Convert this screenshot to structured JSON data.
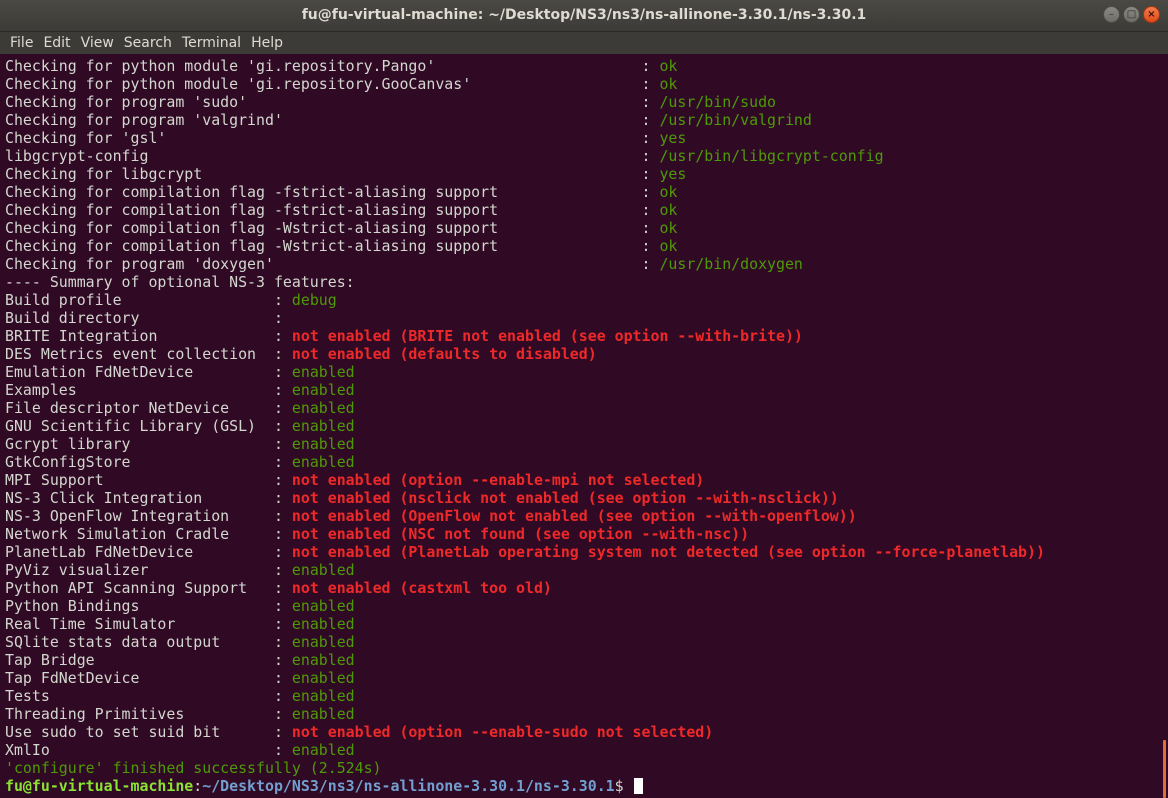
{
  "window": {
    "title": "fu@fu-virtual-machine: ~/Desktop/NS3/ns3/ns-allinone-3.30.1/ns-3.30.1",
    "buttons": {
      "minimize": "–",
      "maximize": "□",
      "close": "×"
    }
  },
  "menu": [
    "File",
    "Edit",
    "View",
    "Search",
    "Terminal",
    "Help"
  ],
  "colors": {
    "background": "#300a24",
    "ok_green": "#4e9a06",
    "error_red": "#ef2929",
    "prompt_user": "#8ae234",
    "prompt_path": "#729fcf"
  },
  "lines": [
    [
      {
        "t": "Checking for python module 'gi.repository.Pango'                       : ",
        "c": "w"
      },
      {
        "t": "ok",
        "c": "g"
      }
    ],
    [
      {
        "t": "Checking for python module 'gi.repository.GooCanvas'                   : ",
        "c": "w"
      },
      {
        "t": "ok",
        "c": "g"
      }
    ],
    [
      {
        "t": "Checking for program 'sudo'                                            : ",
        "c": "w"
      },
      {
        "t": "/usr/bin/sudo",
        "c": "g"
      }
    ],
    [
      {
        "t": "Checking for program 'valgrind'                                        : ",
        "c": "w"
      },
      {
        "t": "/usr/bin/valgrind",
        "c": "g"
      }
    ],
    [
      {
        "t": "Checking for 'gsl'                                                     : ",
        "c": "w"
      },
      {
        "t": "yes",
        "c": "g"
      }
    ],
    [
      {
        "t": "libgcrypt-config                                                       : ",
        "c": "w"
      },
      {
        "t": "/usr/bin/libgcrypt-config",
        "c": "g"
      }
    ],
    [
      {
        "t": "Checking for libgcrypt                                                 : ",
        "c": "w"
      },
      {
        "t": "yes",
        "c": "g"
      }
    ],
    [
      {
        "t": "Checking for compilation flag -fstrict-aliasing support                : ",
        "c": "w"
      },
      {
        "t": "ok",
        "c": "g"
      }
    ],
    [
      {
        "t": "Checking for compilation flag -fstrict-aliasing support                : ",
        "c": "w"
      },
      {
        "t": "ok",
        "c": "g"
      }
    ],
    [
      {
        "t": "Checking for compilation flag -Wstrict-aliasing support                : ",
        "c": "w"
      },
      {
        "t": "ok",
        "c": "g"
      }
    ],
    [
      {
        "t": "Checking for compilation flag -Wstrict-aliasing support                : ",
        "c": "w"
      },
      {
        "t": "ok",
        "c": "g"
      }
    ],
    [
      {
        "t": "Checking for program 'doxygen'                                         : ",
        "c": "w"
      },
      {
        "t": "/usr/bin/doxygen",
        "c": "g"
      }
    ],
    [
      {
        "t": "---- Summary of optional NS-3 features:",
        "c": "w"
      }
    ],
    [
      {
        "t": "Build profile                 : ",
        "c": "w"
      },
      {
        "t": "debug",
        "c": "g"
      }
    ],
    [
      {
        "t": "Build directory               : ",
        "c": "w"
      }
    ],
    [
      {
        "t": "BRITE Integration             : ",
        "c": "w"
      },
      {
        "t": "not enabled (BRITE not enabled (see option --with-brite))",
        "c": "r"
      }
    ],
    [
      {
        "t": "DES Metrics event collection  : ",
        "c": "w"
      },
      {
        "t": "not enabled (defaults to disabled)",
        "c": "r"
      }
    ],
    [
      {
        "t": "Emulation FdNetDevice         : ",
        "c": "w"
      },
      {
        "t": "enabled",
        "c": "g"
      }
    ],
    [
      {
        "t": "Examples                      : ",
        "c": "w"
      },
      {
        "t": "enabled",
        "c": "g"
      }
    ],
    [
      {
        "t": "File descriptor NetDevice     : ",
        "c": "w"
      },
      {
        "t": "enabled",
        "c": "g"
      }
    ],
    [
      {
        "t": "GNU Scientific Library (GSL)  : ",
        "c": "w"
      },
      {
        "t": "enabled",
        "c": "g"
      }
    ],
    [
      {
        "t": "Gcrypt library                : ",
        "c": "w"
      },
      {
        "t": "enabled",
        "c": "g"
      }
    ],
    [
      {
        "t": "GtkConfigStore                : ",
        "c": "w"
      },
      {
        "t": "enabled",
        "c": "g"
      }
    ],
    [
      {
        "t": "MPI Support                   : ",
        "c": "w"
      },
      {
        "t": "not enabled (option --enable-mpi not selected)",
        "c": "r"
      }
    ],
    [
      {
        "t": "NS-3 Click Integration        : ",
        "c": "w"
      },
      {
        "t": "not enabled (nsclick not enabled (see option --with-nsclick))",
        "c": "r"
      }
    ],
    [
      {
        "t": "NS-3 OpenFlow Integration     : ",
        "c": "w"
      },
      {
        "t": "not enabled (OpenFlow not enabled (see option --with-openflow))",
        "c": "r"
      }
    ],
    [
      {
        "t": "Network Simulation Cradle     : ",
        "c": "w"
      },
      {
        "t": "not enabled (NSC not found (see option --with-nsc))",
        "c": "r"
      }
    ],
    [
      {
        "t": "PlanetLab FdNetDevice         : ",
        "c": "w"
      },
      {
        "t": "not enabled (PlanetLab operating system not detected (see option --force-planetlab))",
        "c": "r"
      }
    ],
    [
      {
        "t": "PyViz visualizer              : ",
        "c": "w"
      },
      {
        "t": "enabled",
        "c": "g"
      }
    ],
    [
      {
        "t": "Python API Scanning Support   : ",
        "c": "w"
      },
      {
        "t": "not enabled (castxml too old)",
        "c": "r"
      }
    ],
    [
      {
        "t": "Python Bindings               : ",
        "c": "w"
      },
      {
        "t": "enabled",
        "c": "g"
      }
    ],
    [
      {
        "t": "Real Time Simulator           : ",
        "c": "w"
      },
      {
        "t": "enabled",
        "c": "g"
      }
    ],
    [
      {
        "t": "SQlite stats data output      : ",
        "c": "w"
      },
      {
        "t": "enabled",
        "c": "g"
      }
    ],
    [
      {
        "t": "Tap Bridge                    : ",
        "c": "w"
      },
      {
        "t": "enabled",
        "c": "g"
      }
    ],
    [
      {
        "t": "Tap FdNetDevice               : ",
        "c": "w"
      },
      {
        "t": "enabled",
        "c": "g"
      }
    ],
    [
      {
        "t": "Tests                         : ",
        "c": "w"
      },
      {
        "t": "enabled",
        "c": "g"
      }
    ],
    [
      {
        "t": "Threading Primitives          : ",
        "c": "w"
      },
      {
        "t": "enabled",
        "c": "g"
      }
    ],
    [
      {
        "t": "Use sudo to set suid bit      : ",
        "c": "w"
      },
      {
        "t": "not enabled (option --enable-sudo not selected)",
        "c": "r"
      }
    ],
    [
      {
        "t": "XmlIo                         : ",
        "c": "w"
      },
      {
        "t": "enabled",
        "c": "g"
      }
    ],
    [
      {
        "t": "'configure' finished successfully (2.524s)",
        "c": "g"
      }
    ]
  ],
  "prompt": {
    "user": "fu@fu-virtual-machine",
    "sep": ":",
    "path": "~/Desktop/NS3/ns3/ns-allinone-3.30.1/ns-3.30.1",
    "symbol": "$ "
  }
}
